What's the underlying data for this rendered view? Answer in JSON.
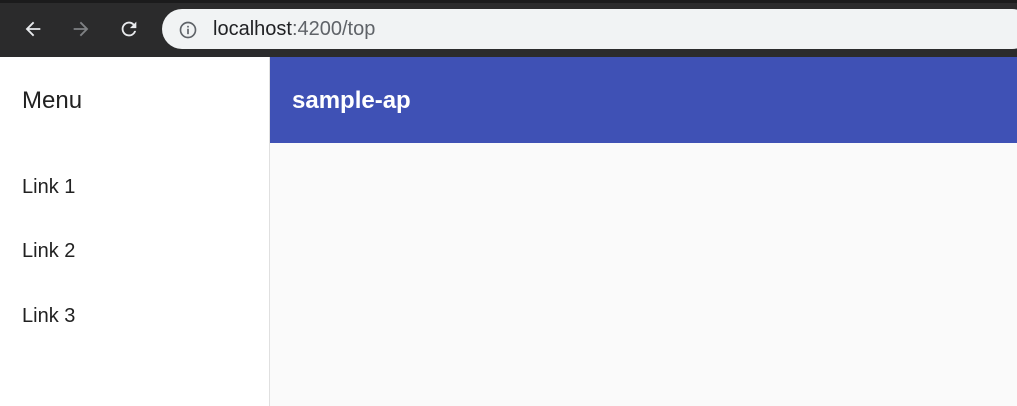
{
  "browser": {
    "url_host": "localhost",
    "url_path": ":4200/top",
    "icons": [
      "back-arrow-icon",
      "forward-arrow-icon",
      "reload-icon",
      "info-icon"
    ]
  },
  "sidenav": {
    "title": "Menu",
    "links": [
      {
        "label": "Link 1"
      },
      {
        "label": "Link 2"
      },
      {
        "label": "Link 3"
      }
    ]
  },
  "toolbar": {
    "title": "sample-ap",
    "color": "#3f51b5"
  }
}
